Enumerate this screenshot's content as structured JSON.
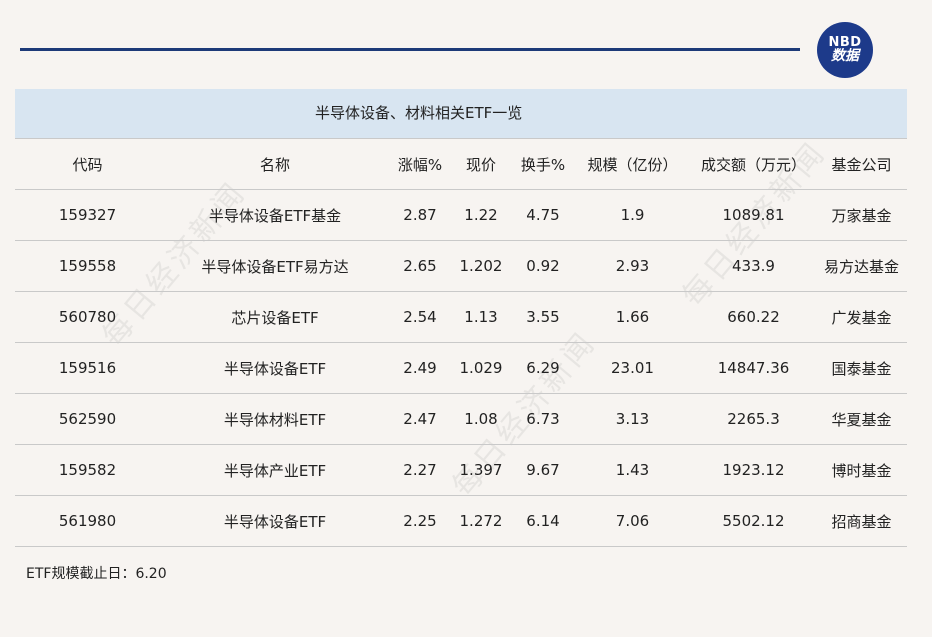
{
  "logo": {
    "line1": "NBD",
    "line2": "数据"
  },
  "title": "半导体设备、材料相关ETF一览",
  "columns": [
    "代码",
    "名称",
    "涨幅%",
    "现价",
    "换手%",
    "规模（亿份）",
    "成交额（万元）",
    "基金公司"
  ],
  "rows": [
    [
      "159327",
      "半导体设备ETF基金",
      "2.87",
      "1.22",
      "4.75",
      "1.9",
      "1089.81",
      "万家基金"
    ],
    [
      "159558",
      "半导体设备ETF易方达",
      "2.65",
      "1.202",
      "0.92",
      "2.93",
      "433.9",
      "易方达基金"
    ],
    [
      "560780",
      "芯片设备ETF",
      "2.54",
      "1.13",
      "3.55",
      "1.66",
      "660.22",
      "广发基金"
    ],
    [
      "159516",
      "半导体设备ETF",
      "2.49",
      "1.029",
      "6.29",
      "23.01",
      "14847.36",
      "国泰基金"
    ],
    [
      "562590",
      "半导体材料ETF",
      "2.47",
      "1.08",
      "6.73",
      "3.13",
      "2265.3",
      "华夏基金"
    ],
    [
      "159582",
      "半导体产业ETF",
      "2.27",
      "1.397",
      "9.67",
      "1.43",
      "1923.12",
      "博时基金"
    ],
    [
      "561980",
      "半导体设备ETF",
      "2.25",
      "1.272",
      "6.14",
      "7.06",
      "5502.12",
      "招商基金"
    ]
  ],
  "footnote": "ETF规模截止日：6.20",
  "watermark": "每日经济新闻",
  "colors": {
    "accent": "#1d3a78",
    "title_bg": "#d8e5f1",
    "page_bg": "#f7f4f1"
  }
}
